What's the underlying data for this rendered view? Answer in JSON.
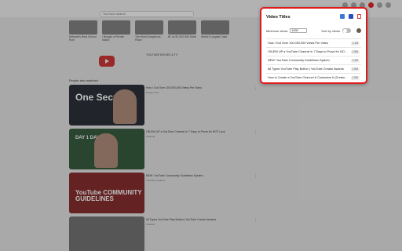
{
  "browser": {
    "search_text": "YouTube search"
  },
  "youtube": {
    "top_videos": [
      "Mrbeast's Best School Run!",
      "I Bought a Private Island",
      "The Most Dangerous Place",
      "$1 vs $1,000,000 Hotel",
      "World's Largest Cake"
    ],
    "feature_text": "YOUTUBE MOVIES & TV",
    "section_title": "People also watched",
    "videos": [
      {
        "thumb_text": "One Secret.",
        "title": "How I Got Over 100,000,000 Views Per Video",
        "meta": "Creator Tips",
        "dots": "⋮"
      },
      {
        "thumb_text": "DAY 1      DAY 7",
        "title": "I BLEW UP a YouTube Channel in 7 Days to Prove it's NOT Luck",
        "meta": "Channel",
        "dots": "⋮"
      },
      {
        "thumb_text": "YouTube COMMUNITY GUIDELINES",
        "title": "NEW: YouTube Community Guidelines System",
        "meta": "YouTube Creators",
        "dots": "⋮"
      },
      {
        "thumb_text": "",
        "title": "All Types YouTube Play Button | YouTube Creator Awards",
        "meta": "Channel",
        "dots": "⋮"
      }
    ]
  },
  "popup": {
    "title": "Video Titles",
    "icons": [
      "copy-icon",
      "save-icon",
      "trash-icon"
    ],
    "min_views_label": "Minimum views",
    "min_views_value": "1000",
    "sort_label": "Sort by views",
    "sort_enabled": false,
    "items": [
      {
        "title": "How I Got Over 100,000,000 Views Per Video",
        "views": "1.1M"
      },
      {
        "title": "I BLEW UP a YouTube Channel in 7 Days to Prove it's NOT Luck",
        "views": "1.5M"
      },
      {
        "title": "NEW: YouTube Community Guidelines System",
        "views": "1.2M"
      },
      {
        "title": "All Types YouTube Play Button | YouTube Creator Awards",
        "views": "1.6M"
      },
      {
        "title": "How to Create a YouTube Channel & Customize It (Creator...)",
        "views": "1.5M"
      }
    ]
  },
  "colors": {
    "popup_border": "#e01a1a"
  }
}
